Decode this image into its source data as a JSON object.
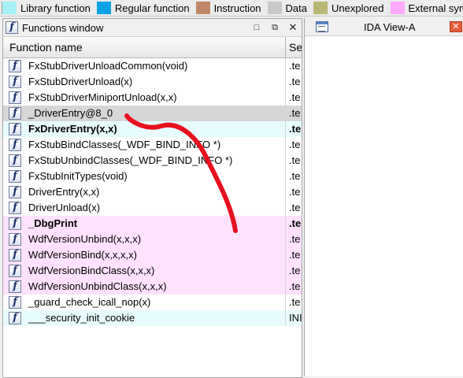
{
  "legend": [
    {
      "label": "Library function",
      "color": "#a8f0f8"
    },
    {
      "label": "Regular function",
      "color": "#0aa2e6"
    },
    {
      "label": "Instruction",
      "color": "#c08868"
    },
    {
      "label": "Data",
      "color": "#c8c8c8"
    },
    {
      "label": "Unexplored",
      "color": "#b8b878"
    },
    {
      "label": "External sym",
      "color": "#ffaaff"
    }
  ],
  "functions_window": {
    "title": "Functions window",
    "columns": {
      "name": "Function name",
      "segment": "Se"
    },
    "rows": [
      {
        "name": "FxStubDriverUnloadCommon(void)",
        "segment": ".te",
        "bg": "#ffffff",
        "bold": false
      },
      {
        "name": "FxStubDriverUnload(x)",
        "segment": ".te",
        "bg": "#ffffff",
        "bold": false
      },
      {
        "name": "FxStubDriverMiniportUnload(x,x)",
        "segment": ".te",
        "bg": "#ffffff",
        "bold": false
      },
      {
        "name": "_DriverEntry@8_0",
        "segment": ".te",
        "bg": "#d6d6d6",
        "bold": false
      },
      {
        "name": "FxDriverEntry(x,x)",
        "segment": ".te",
        "bg": "#e8fcfd",
        "bold": true
      },
      {
        "name": "FxStubBindClasses(_WDF_BIND_INFO *)",
        "segment": ".te",
        "bg": "#ffffff",
        "bold": false
      },
      {
        "name": "FxStubUnbindClasses(_WDF_BIND_INFO *)",
        "segment": ".te",
        "bg": "#ffffff",
        "bold": false
      },
      {
        "name": "FxStubInitTypes(void)",
        "segment": ".te",
        "bg": "#ffffff",
        "bold": false
      },
      {
        "name": "DriverEntry(x,x)",
        "segment": ".te",
        "bg": "#ffffff",
        "bold": false
      },
      {
        "name": "DriverUnload(x)",
        "segment": ".te",
        "bg": "#ffffff",
        "bold": false
      },
      {
        "name": "_DbgPrint",
        "segment": ".te",
        "bg": "#ffe2fe",
        "bold": true
      },
      {
        "name": "WdfVersionUnbind(x,x,x)",
        "segment": ".te",
        "bg": "#ffe2fe",
        "bold": false
      },
      {
        "name": "WdfVersionBind(x,x,x,x)",
        "segment": ".te",
        "bg": "#ffe2fe",
        "bold": false
      },
      {
        "name": "WdfVersionBindClass(x,x,x)",
        "segment": ".te",
        "bg": "#ffe2fe",
        "bold": false
      },
      {
        "name": "WdfVersionUnbindClass(x,x,x)",
        "segment": ".te",
        "bg": "#ffe2fe",
        "bold": false
      },
      {
        "name": "_guard_check_icall_nop(x)",
        "segment": ".te",
        "bg": "#ffffff",
        "bold": false
      },
      {
        "name": "___security_init_cookie",
        "segment": "INI",
        "bg": "#e8fcfd",
        "bold": false
      }
    ]
  },
  "ida_view": {
    "title": "IDA View-A"
  },
  "annotation": {
    "color": "#e8101e"
  }
}
